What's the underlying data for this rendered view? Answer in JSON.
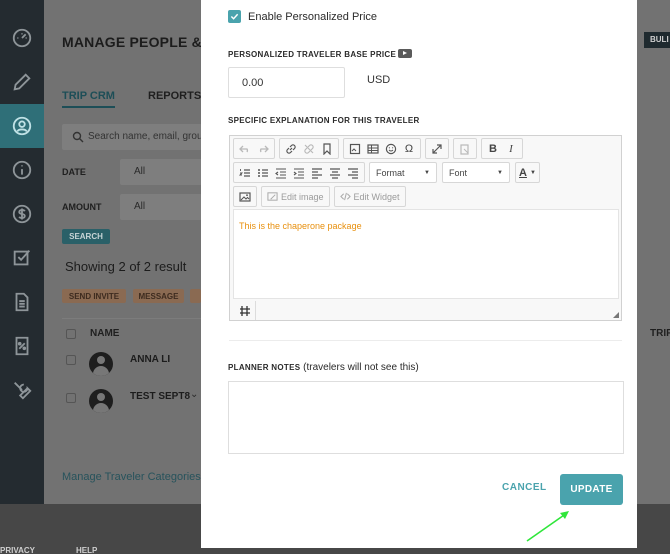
{
  "background": {
    "title": "MANAGE PEOPLE & R",
    "bulk_label": "BULI",
    "tabs": [
      "TRIP CRM",
      "REPORTS"
    ],
    "search_placeholder": "Search name, email, grou",
    "filters": [
      {
        "label": "DATE",
        "value": "All"
      },
      {
        "label": "AMOUNT",
        "value": "All"
      }
    ],
    "search_button": "SEARCH",
    "showing": "Showing 2 of 2 result",
    "bulk_actions": [
      "SEND INVITE",
      "MESSAGE"
    ],
    "table": {
      "name_header": "NAME",
      "trip_header": "TRIP",
      "rows": [
        {
          "name": "ANNA LI"
        },
        {
          "name": "TEST SEPT8"
        }
      ]
    },
    "manage_link": "Manage Traveler Categories",
    "footer": [
      "PRIVACY",
      "HELP"
    ],
    "sidebar_icons": [
      "dashboard-icon",
      "pencil-icon",
      "people-icon",
      "info-icon",
      "dollar-icon",
      "checklist-icon",
      "document-icon",
      "coupon-icon",
      "wrench-icon"
    ],
    "sidebar_active_index": 2
  },
  "modal": {
    "enable_price_label": "Enable Personalized Price",
    "enable_price_checked": true,
    "base_price_label": "PERSONALIZED TRAVELER BASE PRICE",
    "base_price_value": "0.00",
    "currency": "USD",
    "explanation_label": "SPECIFIC EXPLANATION FOR THIS TRAVELER",
    "editor": {
      "format_label": "Format",
      "font_label": "Font",
      "edit_image_label": "Edit image",
      "edit_widget_label": "Edit Widget",
      "content": "This is the chaperone package"
    },
    "planner_notes_label_bold": "PLANNER NOTES",
    "planner_notes_label_rest": " (travelers will not see this)",
    "planner_notes_value": "",
    "cancel_label": "CANCEL",
    "update_label": "UPDATE"
  },
  "colors": {
    "accent": "#4aa3ad",
    "editor_text": "#e8900e",
    "annotation_arrow": "#2fe63a"
  }
}
